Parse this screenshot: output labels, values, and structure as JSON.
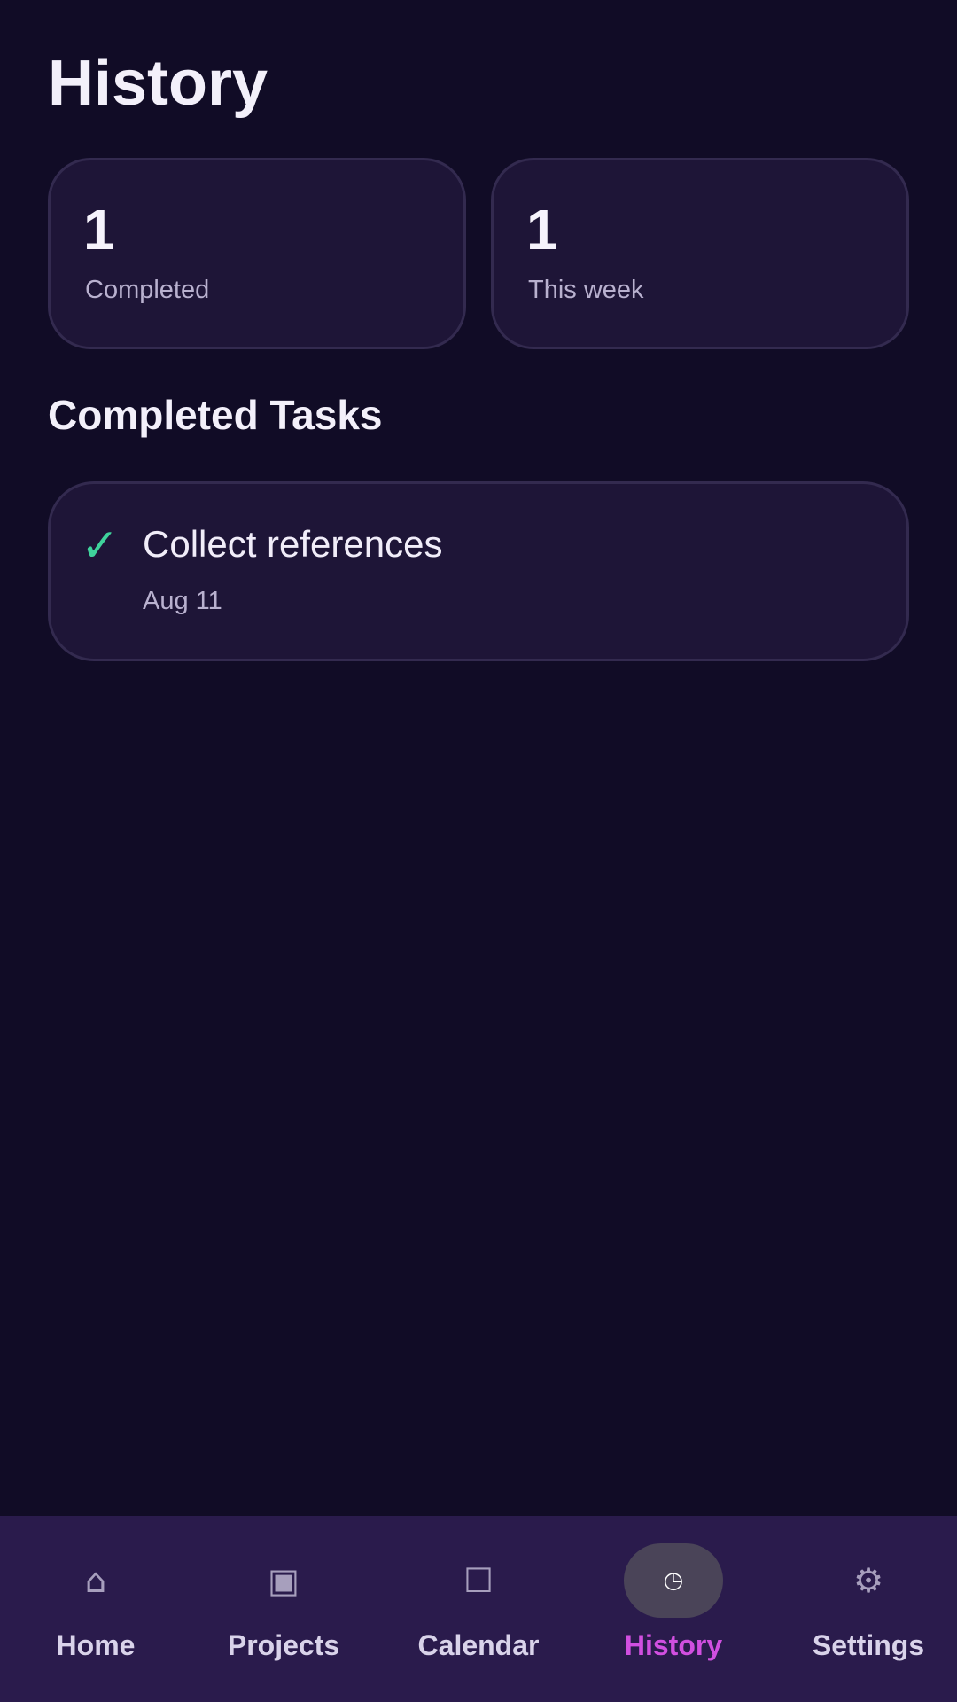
{
  "header": {
    "title": "History"
  },
  "stats": [
    {
      "value": "1",
      "label": "Completed"
    },
    {
      "value": "1",
      "label": "This week"
    }
  ],
  "section": {
    "title": "Completed Tasks"
  },
  "tasks": [
    {
      "check_glyph": "✓",
      "title": "Collect references",
      "date": "Aug 11",
      "status_color": "#3fd29b"
    }
  ],
  "nav": {
    "active": "History",
    "active_color": "#d14fe0",
    "items": [
      {
        "label": "Home",
        "icon": "home-icon",
        "glyph": "⌂"
      },
      {
        "label": "Projects",
        "icon": "projects-icon",
        "glyph": "▣"
      },
      {
        "label": "Calendar",
        "icon": "calendar-icon",
        "glyph": "☐"
      },
      {
        "label": "History",
        "icon": "clock-icon",
        "glyph": "◷"
      },
      {
        "label": "Settings",
        "icon": "gear-icon",
        "glyph": "⚙"
      }
    ]
  }
}
